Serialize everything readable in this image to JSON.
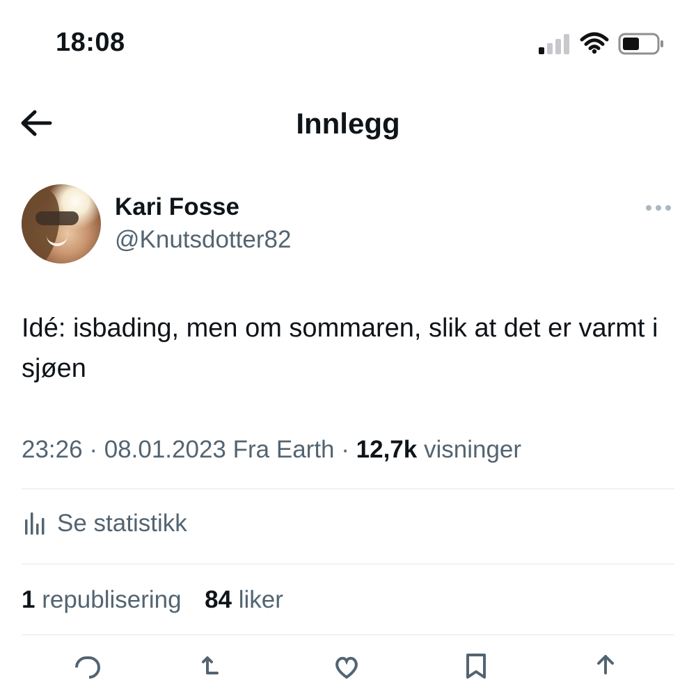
{
  "status_bar": {
    "time": "18:08"
  },
  "header": {
    "title": "Innlegg"
  },
  "post": {
    "author_name": "Kari Fosse",
    "author_handle": "@Knutsdotter82",
    "text": "Idé: isbading, men om sommaren, slik at det er varmt i sjøen",
    "time": "23:26",
    "date": "08.01.2023",
    "source": "Fra Earth",
    "views_count": "12,7k",
    "views_label": "visninger",
    "stats_label": "Se statistikk",
    "reposts_count": "1",
    "reposts_label": "republisering",
    "likes_count": "84",
    "likes_label": "liker"
  },
  "icons": {
    "back": "arrow-left-icon",
    "more": "more-horizontal-icon",
    "stats": "bar-chart-icon",
    "actions": [
      "reply-icon",
      "repost-icon",
      "like-icon",
      "bookmark-icon",
      "share-icon"
    ]
  },
  "colors": {
    "primary_text": "#0f1419",
    "secondary_text": "#536471",
    "divider": "#eff3f4"
  }
}
